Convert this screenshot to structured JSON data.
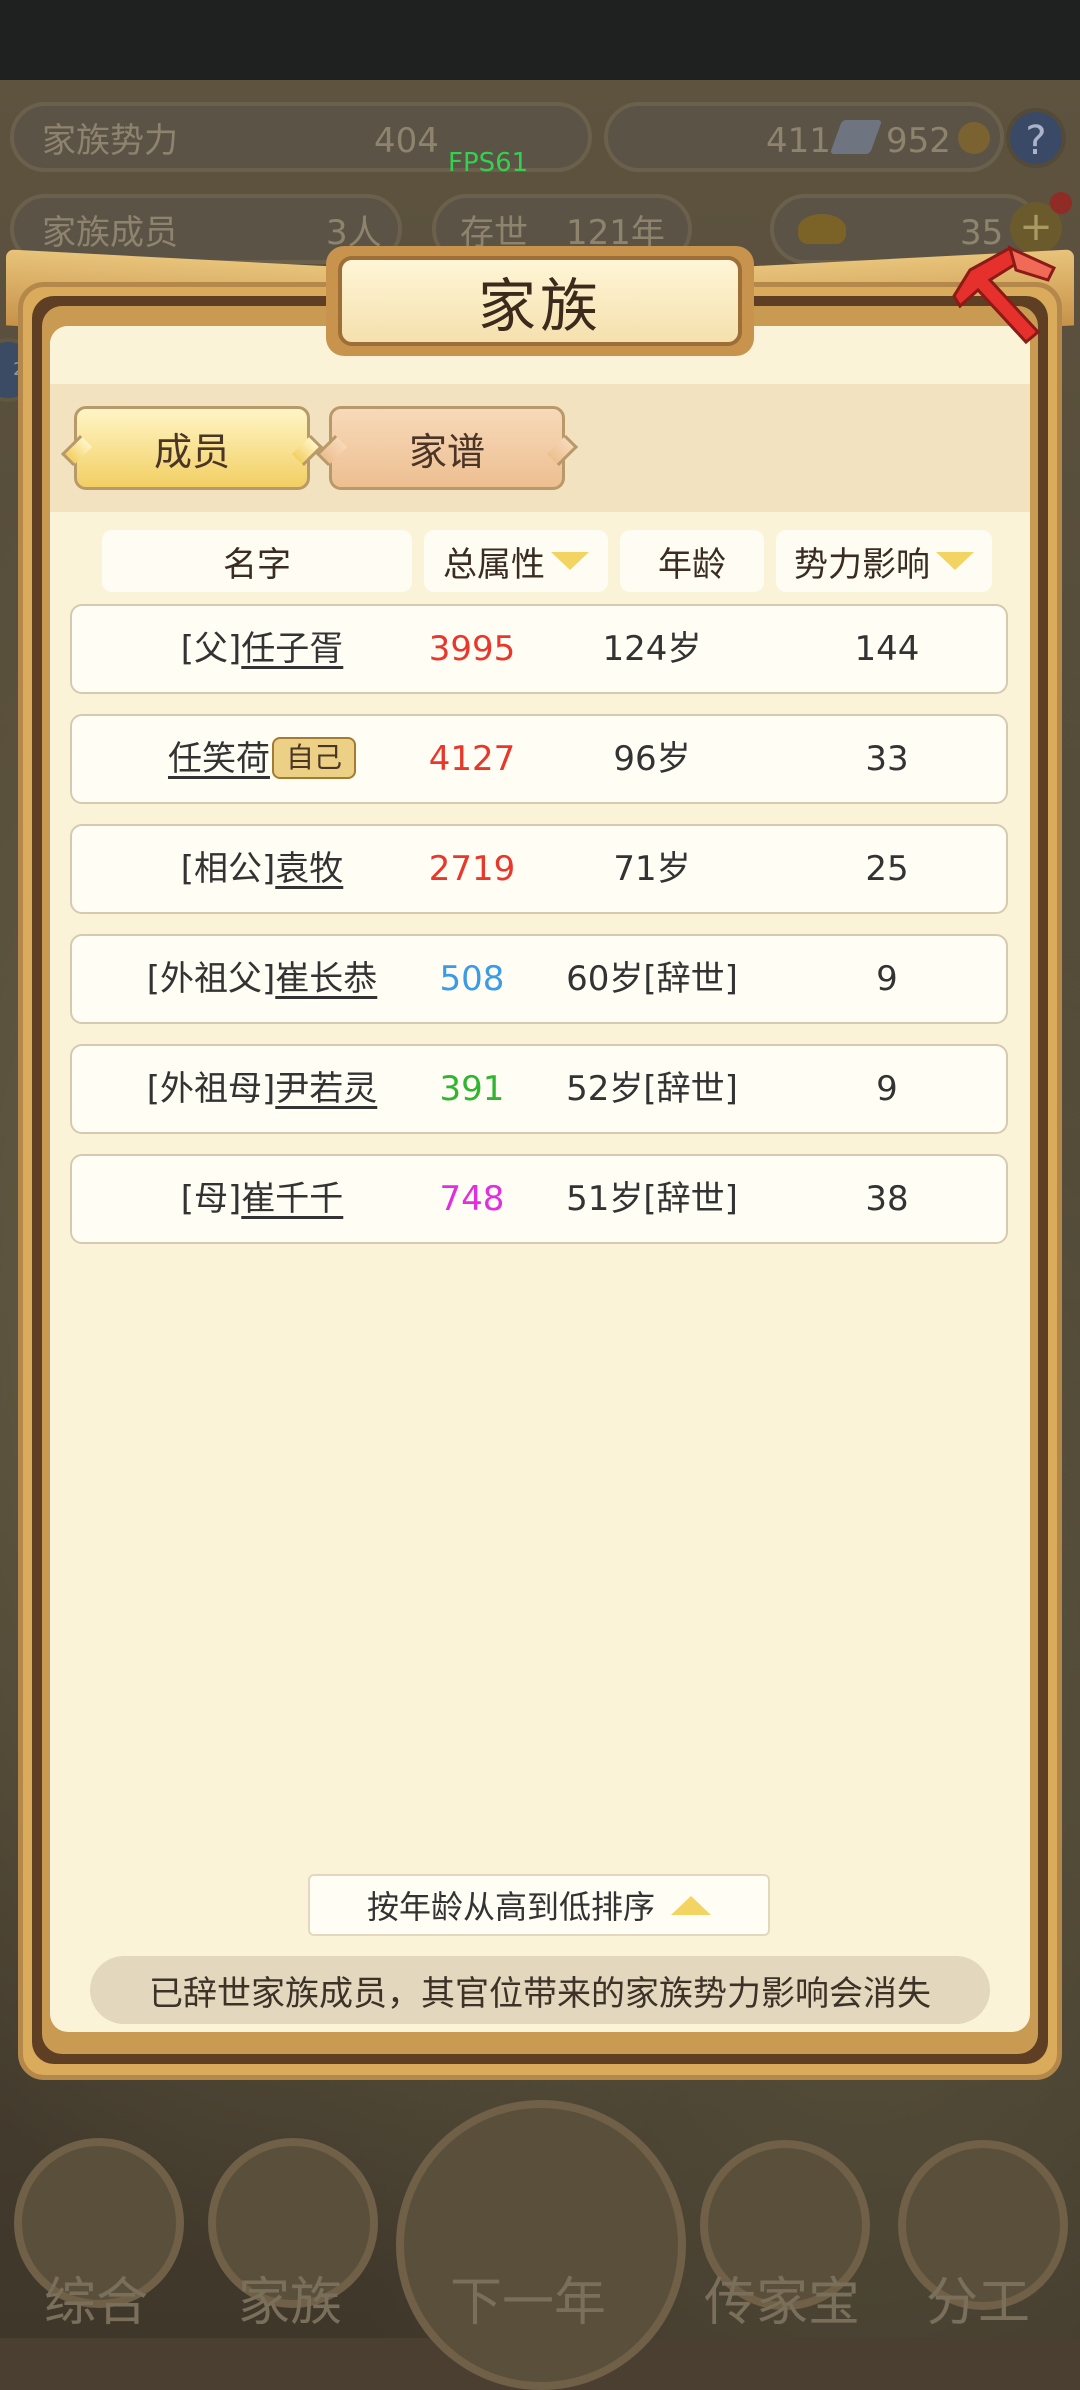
{
  "hud": {
    "fps": "FPS61",
    "clan_power_label": "家族势力",
    "clan_power_value": "404",
    "clan_members_label": "家族成员",
    "clan_members_value": "3人",
    "survival_label": "存世",
    "survival_value": "121年",
    "silver": "411",
    "copper": "952",
    "gold": "35",
    "help": "?",
    "plus": "+",
    "side_badge": "22"
  },
  "bottom_nav": [
    "综合",
    "家族",
    "下一年",
    "传家宝",
    "分工"
  ],
  "dialog": {
    "title": "家族",
    "tabs": {
      "members": "成员",
      "genealogy": "家谱"
    },
    "columns": {
      "name": "名字",
      "attr": "总属性",
      "age": "年龄",
      "influence": "势力影响"
    },
    "self_badge": "自己",
    "rows": [
      {
        "prefix": "[父]",
        "name": "任子胥",
        "attr": "3995",
        "attr_color": "#e8372b",
        "age": "124岁",
        "influence": "144"
      },
      {
        "prefix": "",
        "name": "任笑荷",
        "attr": "4127",
        "attr_color": "#e8372b",
        "age": "96岁",
        "influence": "33"
      },
      {
        "prefix": "[相公]",
        "name": "袁牧",
        "attr": "2719",
        "attr_color": "#e8372b",
        "age": "71岁",
        "influence": "25"
      },
      {
        "prefix": "[外祖父]",
        "name": "崔长恭",
        "attr": "508",
        "attr_color": "#3a9be6",
        "age": "60岁[辞世]",
        "influence": "9"
      },
      {
        "prefix": "[外祖母]",
        "name": "尹若灵",
        "attr": "391",
        "attr_color": "#2fb52f",
        "age": "52岁[辞世]",
        "influence": "9"
      },
      {
        "prefix": "[母]",
        "name": "崔千千",
        "attr": "748",
        "attr_color": "#e02ee0",
        "age": "51岁[辞世]",
        "influence": "38"
      }
    ],
    "sort_label": "按年龄从高到低排序",
    "notice": "已辞世家族成员，其官位带来的家族势力影响会消失"
  }
}
